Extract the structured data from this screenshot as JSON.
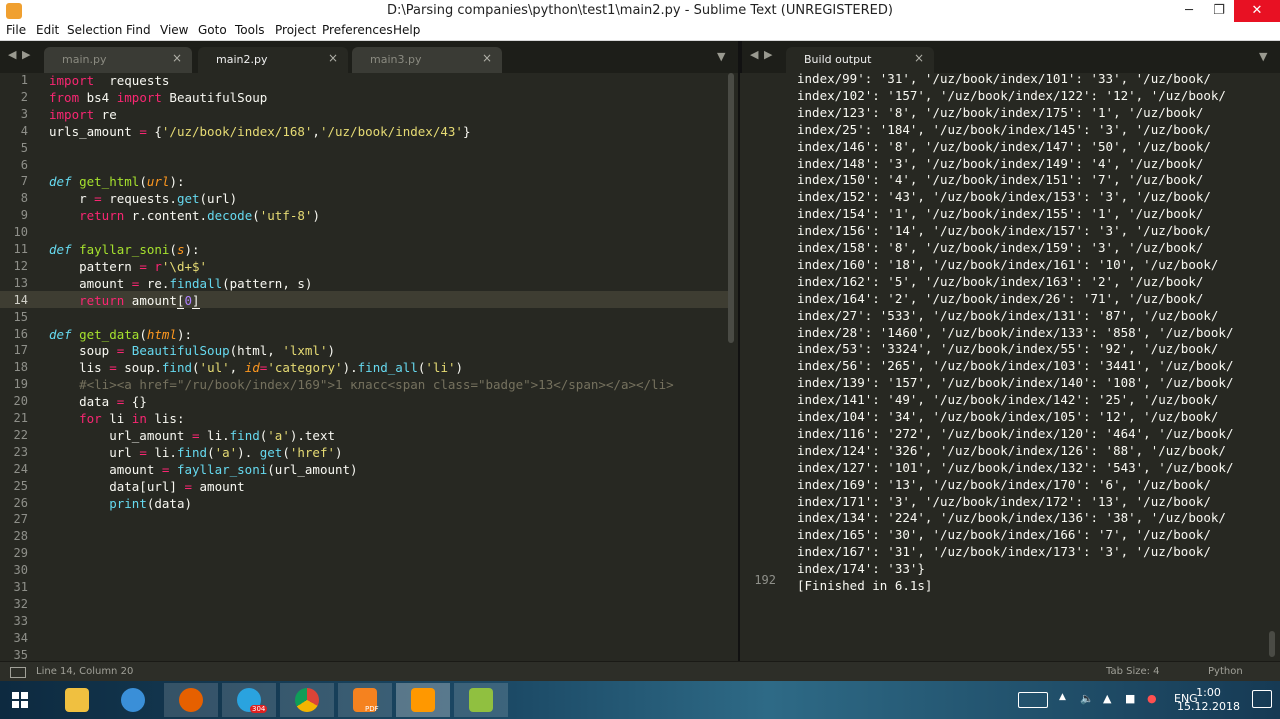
{
  "window": {
    "title": "D:\\Parsing companies\\python\\test1\\main2.py - Sublime Text (UNREGISTERED)",
    "minimize": "─",
    "maximize": "❐",
    "close": "✕"
  },
  "menu": [
    "File",
    "Edit",
    "Selection",
    "Find",
    "View",
    "Goto",
    "Tools",
    "Project",
    "Preferences",
    "Help"
  ],
  "tabs": [
    {
      "label": "main.py",
      "active": false
    },
    {
      "label": "main2.py",
      "active": true
    },
    {
      "label": "main3.py",
      "active": false
    }
  ],
  "output_tab": {
    "label": "Build output"
  },
  "tab_close_glyph": "×",
  "tab_nav": {
    "left": "◀",
    "right": "▶",
    "dropdown": "▼"
  },
  "editor": {
    "line_numbers": [
      "1",
      "2",
      "3",
      "4",
      "5",
      "6",
      "7",
      "8",
      "9",
      "10",
      "11",
      "12",
      "13",
      "14",
      "15",
      "16",
      "17",
      "18",
      "19",
      "20",
      "21",
      "22",
      "23",
      "24",
      "25",
      "26",
      "27",
      "28",
      "29",
      "30",
      "31",
      "32",
      "33",
      "34",
      "35"
    ],
    "current_line": 14,
    "lines": [
      [
        [
          "kw",
          "import"
        ],
        [
          "",
          "  requests"
        ]
      ],
      [
        [
          "kw",
          "from"
        ],
        [
          "",
          " bs4 "
        ],
        [
          "kw",
          "import"
        ],
        [
          "",
          " BeautifulSoup"
        ]
      ],
      [
        [
          "kw",
          "import"
        ],
        [
          "",
          " re"
        ]
      ],
      [
        [
          "",
          "urls_amount "
        ],
        [
          "kw",
          "="
        ],
        [
          "",
          " {"
        ],
        [
          "st",
          "'/uz/book/index/168'"
        ],
        [
          "",
          ","
        ],
        [
          "st",
          "'/uz/book/index/43'"
        ],
        [
          "",
          "}"
        ]
      ],
      [],
      [],
      [
        [
          "it",
          "def"
        ],
        [
          "",
          " "
        ],
        [
          "fn",
          "get_html"
        ],
        [
          "",
          "("
        ],
        [
          "pa",
          "url"
        ],
        [
          "",
          "):"
        ]
      ],
      [
        [
          "",
          "    r "
        ],
        [
          "kw",
          "="
        ],
        [
          "",
          " requests."
        ],
        [
          "bi",
          "get"
        ],
        [
          "",
          "(url)"
        ]
      ],
      [
        [
          "",
          "    "
        ],
        [
          "kw",
          "return"
        ],
        [
          "",
          " r.content."
        ],
        [
          "bi",
          "decode"
        ],
        [
          "",
          "("
        ],
        [
          "st",
          "'utf-8'"
        ],
        [
          "",
          ")"
        ]
      ],
      [],
      [
        [
          "it",
          "def"
        ],
        [
          "",
          " "
        ],
        [
          "fn",
          "fayllar_soni"
        ],
        [
          "",
          "("
        ],
        [
          "pa",
          "s"
        ],
        [
          "",
          "):"
        ]
      ],
      [
        [
          "",
          "    pattern "
        ],
        [
          "kw",
          "="
        ],
        [
          "",
          " "
        ],
        [
          "kw",
          "r"
        ],
        [
          "st",
          "'\\d+$'"
        ]
      ],
      [
        [
          "",
          "    amount "
        ],
        [
          "kw",
          "="
        ],
        [
          "",
          " re."
        ],
        [
          "bi",
          "findall"
        ],
        [
          "",
          "(pattern, s)"
        ]
      ],
      [
        [
          "",
          "    "
        ],
        [
          "kw",
          "return"
        ],
        [
          "",
          " amount"
        ],
        [
          "b",
          "["
        ],
        [
          "nu",
          "0"
        ],
        [
          "b",
          "]"
        ]
      ],
      [],
      [
        [
          "it",
          "def"
        ],
        [
          "",
          " "
        ],
        [
          "fn",
          "get_data"
        ],
        [
          "",
          "("
        ],
        [
          "pa",
          "html"
        ],
        [
          "",
          "):"
        ]
      ],
      [
        [
          "",
          "    soup "
        ],
        [
          "kw",
          "="
        ],
        [
          "",
          " "
        ],
        [
          "bi",
          "BeautifulSoup"
        ],
        [
          "",
          "(html, "
        ],
        [
          "st",
          "'lxml'"
        ],
        [
          "",
          ")"
        ]
      ],
      [
        [
          "",
          "    lis "
        ],
        [
          "kw",
          "="
        ],
        [
          "",
          " soup."
        ],
        [
          "bi",
          "find"
        ],
        [
          "",
          "("
        ],
        [
          "st",
          "'ul'"
        ],
        [
          "",
          ", "
        ],
        [
          "pa",
          "id"
        ],
        [
          "kw",
          "="
        ],
        [
          "st",
          "'category'"
        ],
        [
          "",
          ")."
        ],
        [
          "bi",
          "find_all"
        ],
        [
          "",
          "("
        ],
        [
          "st",
          "'li'"
        ],
        [
          "",
          ")"
        ]
      ],
      [
        [
          "",
          "    "
        ],
        [
          "cm",
          "#<li><a href=\"/ru/book/index/169\">1 класс<span class=\"badge\">13</span></a></li>"
        ]
      ],
      [
        [
          "",
          "    data "
        ],
        [
          "kw",
          "="
        ],
        [
          "",
          " {}"
        ]
      ],
      [
        [
          "",
          "    "
        ],
        [
          "kw",
          "for"
        ],
        [
          "",
          " li "
        ],
        [
          "kw",
          "in"
        ],
        [
          "",
          " lis:"
        ]
      ],
      [
        [
          "",
          "        url_amount "
        ],
        [
          "kw",
          "="
        ],
        [
          "",
          " li."
        ],
        [
          "bi",
          "find"
        ],
        [
          "",
          "("
        ],
        [
          "st",
          "'a'"
        ],
        [
          "",
          ").text"
        ]
      ],
      [
        [
          "",
          "        url "
        ],
        [
          "kw",
          "="
        ],
        [
          "",
          " li."
        ],
        [
          "bi",
          "find"
        ],
        [
          "",
          "("
        ],
        [
          "st",
          "'a'"
        ],
        [
          "",
          "). "
        ],
        [
          "bi",
          "get"
        ],
        [
          "",
          "("
        ],
        [
          "st",
          "'href'"
        ],
        [
          "",
          ")"
        ]
      ],
      [
        [
          "",
          "        amount "
        ],
        [
          "kw",
          "="
        ],
        [
          "",
          " "
        ],
        [
          "bi",
          "fayllar_soni"
        ],
        [
          "",
          "(url_amount)"
        ]
      ],
      [
        [
          "",
          "        data[url] "
        ],
        [
          "kw",
          "="
        ],
        [
          "",
          " amount"
        ]
      ],
      [
        [
          "",
          "        "
        ],
        [
          "bi",
          "print"
        ],
        [
          "",
          "(data)"
        ]
      ]
    ]
  },
  "output": {
    "lines": [
      "index/99': '31', '/uz/book/index/101': '33', '/uz/book/",
      "index/102': '157', '/uz/book/index/122': '12', '/uz/book/",
      "index/123': '8', '/uz/book/index/175': '1', '/uz/book/",
      "index/25': '184', '/uz/book/index/145': '3', '/uz/book/",
      "index/146': '8', '/uz/book/index/147': '50', '/uz/book/",
      "index/148': '3', '/uz/book/index/149': '4', '/uz/book/",
      "index/150': '4', '/uz/book/index/151': '7', '/uz/book/",
      "index/152': '43', '/uz/book/index/153': '3', '/uz/book/",
      "index/154': '1', '/uz/book/index/155': '1', '/uz/book/",
      "index/156': '14', '/uz/book/index/157': '3', '/uz/book/",
      "index/158': '8', '/uz/book/index/159': '3', '/uz/book/",
      "index/160': '18', '/uz/book/index/161': '10', '/uz/book/",
      "index/162': '5', '/uz/book/index/163': '2', '/uz/book/",
      "index/164': '2', '/uz/book/index/26': '71', '/uz/book/",
      "index/27': '533', '/uz/book/index/131': '87', '/uz/book/",
      "index/28': '1460', '/uz/book/index/133': '858', '/uz/book/",
      "index/53': '3324', '/uz/book/index/55': '92', '/uz/book/",
      "index/56': '265', '/uz/book/index/103': '3441', '/uz/book/",
      "index/139': '157', '/uz/book/index/140': '108', '/uz/book/",
      "index/141': '49', '/uz/book/index/142': '25', '/uz/book/",
      "index/104': '34', '/uz/book/index/105': '12', '/uz/book/",
      "index/116': '272', '/uz/book/index/120': '464', '/uz/book/",
      "index/124': '326', '/uz/book/index/126': '88', '/uz/book/",
      "index/127': '101', '/uz/book/index/132': '543', '/uz/book/",
      "index/169': '13', '/uz/book/index/170': '6', '/uz/book/",
      "index/171': '3', '/uz/book/index/172': '13', '/uz/book/",
      "index/134': '224', '/uz/book/index/136': '38', '/uz/book/",
      "index/165': '30', '/uz/book/index/166': '7', '/uz/book/",
      "index/167': '31', '/uz/book/index/173': '3', '/uz/book/",
      "index/174': '33'}",
      "[Finished in 6.1s]"
    ],
    "last_line_number": "192"
  },
  "status": {
    "position": "Line 14, Column 20",
    "tab_size": "Tab Size: 4",
    "syntax": "Python"
  },
  "taskbar": {
    "telegram_badge": "304",
    "pdf_label": "PDF",
    "language": "ENG",
    "time": "1:00",
    "date": "15.12.2018",
    "tray_chevron": "▲"
  },
  "colors": {
    "editor_bg": "#272822",
    "keyword": "#f92672",
    "function": "#a6e22e",
    "string": "#e6db74",
    "builtin": "#66d9ef",
    "param": "#fd971f",
    "number": "#ae81ff",
    "comment": "#75715e"
  }
}
